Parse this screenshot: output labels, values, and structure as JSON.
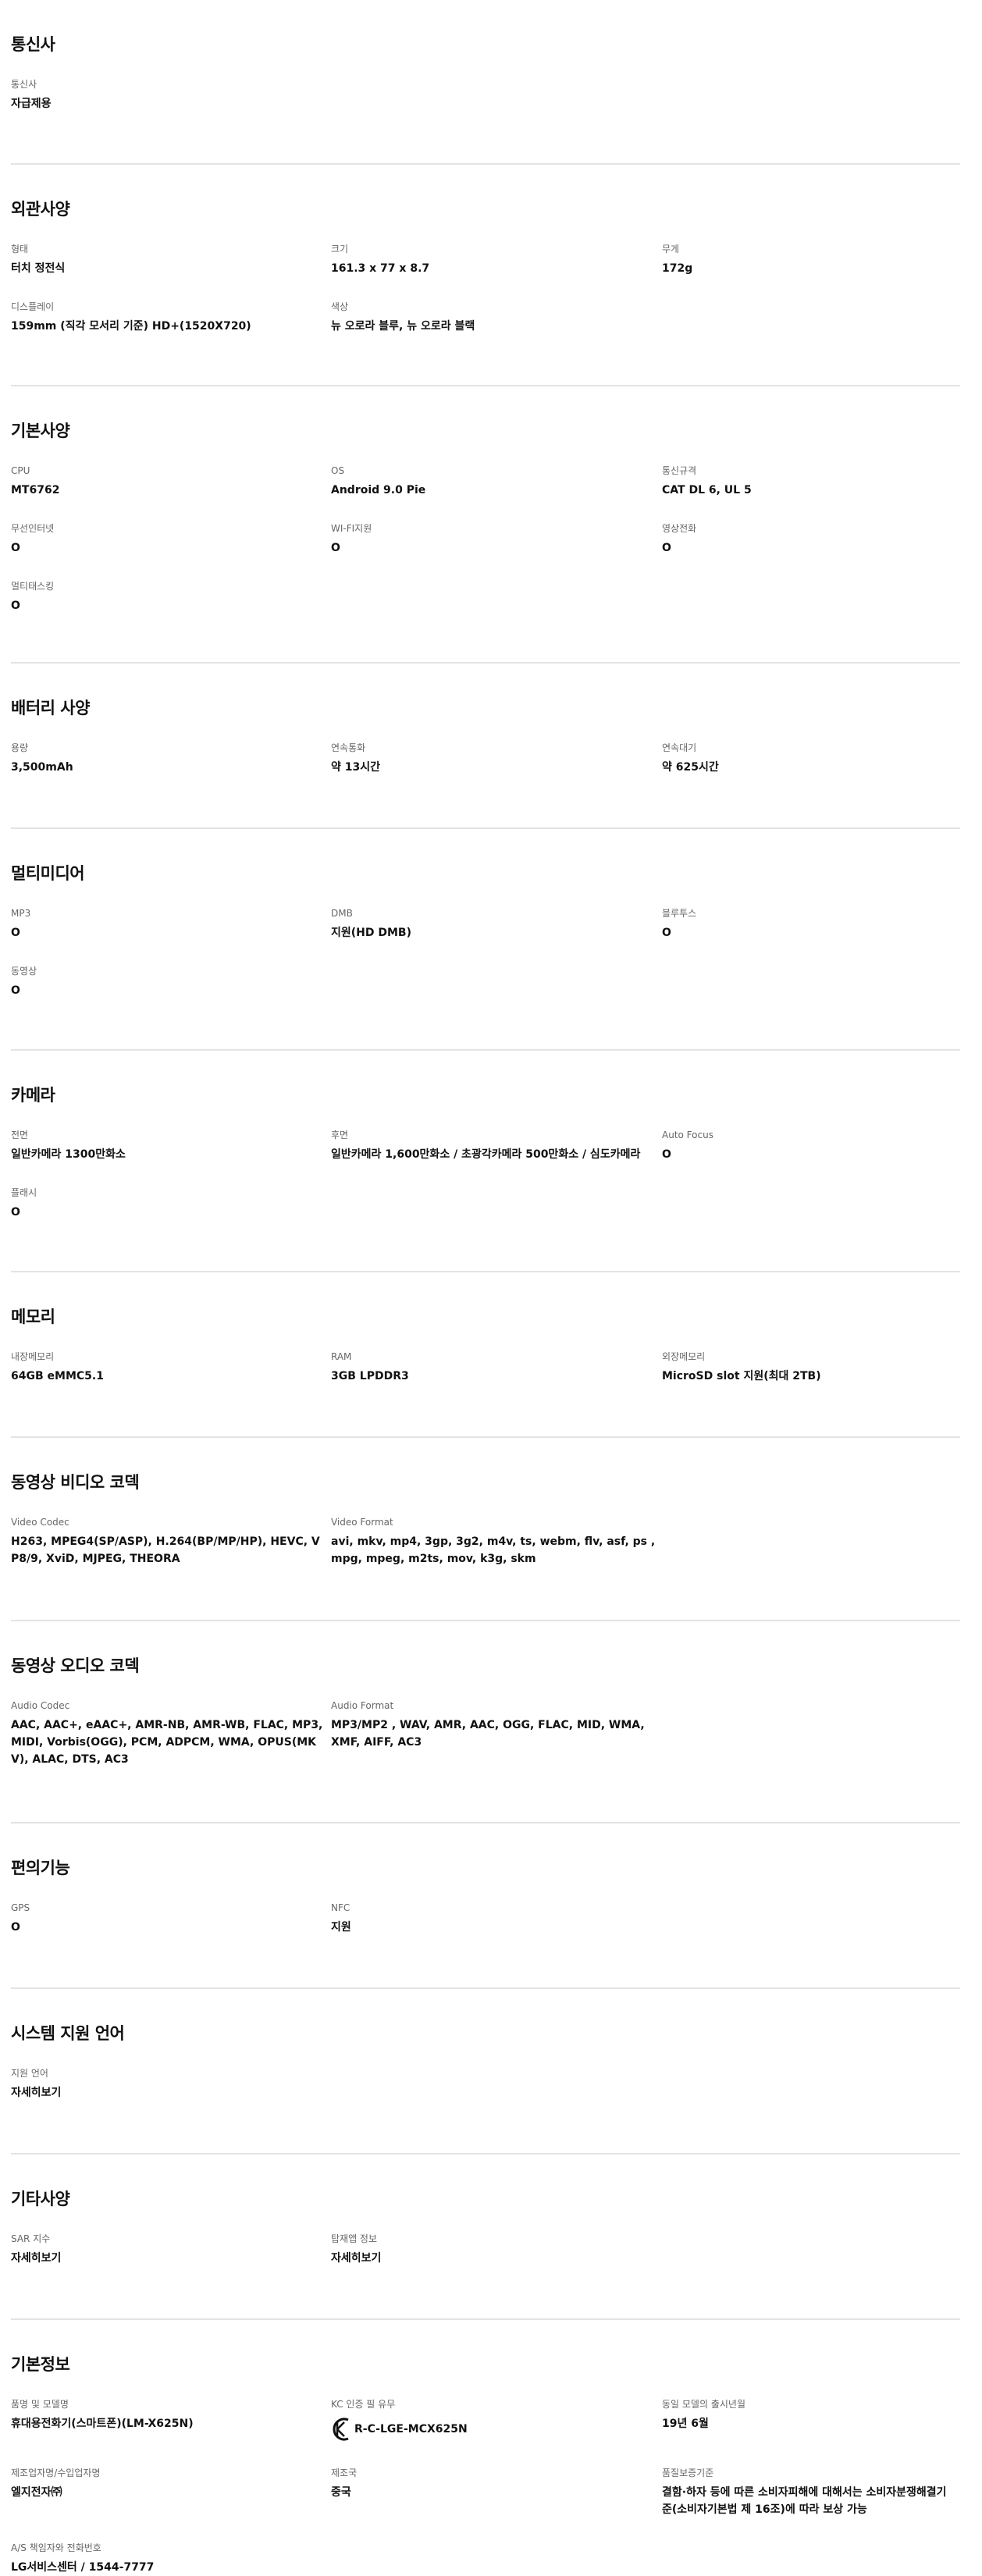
{
  "sections": [
    {
      "title": "통신사",
      "items": [
        {
          "label": "통신사",
          "value": "자급제용"
        }
      ]
    },
    {
      "title": "외관사양",
      "items": [
        {
          "label": "형태",
          "value": "터치 정전식"
        },
        {
          "label": "크기",
          "value": "161.3 x 77 x 8.7"
        },
        {
          "label": "무게",
          "value": "172g"
        },
        {
          "label": "디스플레이",
          "value": "159mm (직각 모서리 기준) HD+(1520X720)"
        },
        {
          "label": "색상",
          "value": "뉴 오로라 블루, 뉴 오로라 블랙"
        }
      ]
    },
    {
      "title": "기본사양",
      "items": [
        {
          "label": "CPU",
          "value": "MT6762"
        },
        {
          "label": "OS",
          "value": "Android 9.0 Pie"
        },
        {
          "label": "통신규격",
          "value": "CAT DL 6, UL 5"
        },
        {
          "label": "무선인터넷",
          "value": "O"
        },
        {
          "label": "WI-FI지원",
          "value": "O"
        },
        {
          "label": "영상전화",
          "value": "O"
        },
        {
          "label": "멀티태스킹",
          "value": "O"
        }
      ]
    },
    {
      "title": "배터리 사양",
      "items": [
        {
          "label": "용량",
          "value": "3,500mAh"
        },
        {
          "label": "연속통화",
          "value": "약 13시간"
        },
        {
          "label": "연속대기",
          "value": "약 625시간"
        }
      ]
    },
    {
      "title": "멀티미디어",
      "items": [
        {
          "label": "MP3",
          "value": "O"
        },
        {
          "label": "DMB",
          "value": "지원(HD DMB)"
        },
        {
          "label": "블루투스",
          "value": "O"
        },
        {
          "label": "동영상",
          "value": "O"
        }
      ]
    },
    {
      "title": "카메라",
      "items": [
        {
          "label": "전면",
          "value": "일반카메라 1300만화소"
        },
        {
          "label": "후면",
          "value": "일반카메라 1,600만화소 / 초광각카메라 500만화소 / 심도카메라"
        },
        {
          "label": "Auto Focus",
          "value": "O"
        },
        {
          "label": "플래시",
          "value": "O"
        }
      ]
    },
    {
      "title": "메모리",
      "items": [
        {
          "label": "내장메모리",
          "value": "64GB eMMC5.1"
        },
        {
          "label": "RAM",
          "value": "3GB LPDDR3"
        },
        {
          "label": "외장메모리",
          "value": "MicroSD slot 지원(최대 2TB)"
        }
      ]
    },
    {
      "title": "동영상 비디오 코덱",
      "items": [
        {
          "label": "Video Codec",
          "value": "H263, MPEG4(SP/ASP), H.264(BP/MP/HP), HEVC, VP8/9, XviD, MJPEG, THEORA"
        },
        {
          "label": "Video Format",
          "value": "avi, mkv, mp4, 3gp, 3g2, m4v, ts, webm, flv, asf, ps , mpg, mpeg, m2ts, mov, k3g, skm"
        }
      ]
    },
    {
      "title": "동영상 오디오 코덱",
      "items": [
        {
          "label": "Audio Codec",
          "value": "AAC, AAC+, eAAC+, AMR-NB, AMR-WB, FLAC, MP3, MIDI, Vorbis(OGG), PCM, ADPCM, WMA, OPUS(MKV), ALAC, DTS, AC3"
        },
        {
          "label": "Audio Format",
          "value": "MP3/MP2 , WAV, AMR, AAC, OGG, FLAC, MID, WMA, XMF, AIFF, AC3"
        }
      ]
    },
    {
      "title": "편의기능",
      "items": [
        {
          "label": "GPS",
          "value": "O"
        },
        {
          "label": "NFC",
          "value": "지원"
        }
      ]
    },
    {
      "title": "시스템 지원 언어",
      "items": [
        {
          "label": "지원 언어",
          "value": "자세히보기"
        }
      ]
    },
    {
      "title": "기타사양",
      "items": [
        {
          "label": "SAR 지수",
          "value": "자세히보기"
        },
        {
          "label": "탑재앱 정보",
          "value": "자세히보기"
        }
      ]
    },
    {
      "title": "기본정보",
      "items": [
        {
          "label": "품명 및 모델명",
          "value": "휴대용전화기(스마트폰)(LM-X625N)"
        },
        {
          "label": "KC 인증 필 유무",
          "value": "R-C-LGE-MCX625N",
          "kc": true
        },
        {
          "label": "동일 모델의 출시년월",
          "value": "19년 6월"
        },
        {
          "label": "제조업자명/수입업자명",
          "value": "엘지전자㈜"
        },
        {
          "label": "제조국",
          "value": "중국"
        },
        {
          "label": "품질보증기준",
          "value": "결함·하자 등에 따른 소비자피해에 대해서는 소비자분쟁해결기준(소비자기본법 제 16조)에 따라 보상 가능"
        },
        {
          "label": "A/S 책임자와 전화번호",
          "value": "LG서비스센터 / 1544-7777"
        }
      ]
    }
  ]
}
